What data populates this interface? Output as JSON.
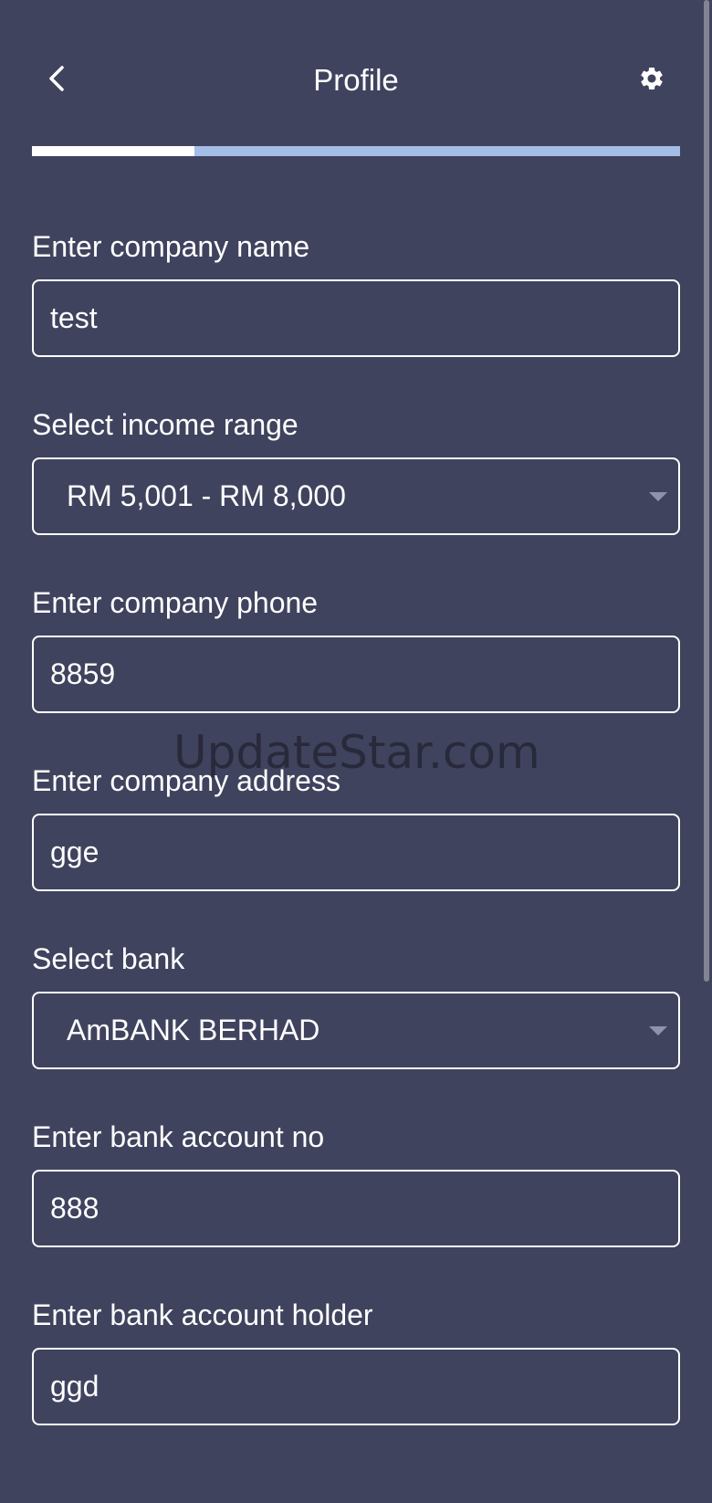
{
  "header": {
    "title": "Profile",
    "back_icon": "chevron-left-icon",
    "settings_icon": "gear-icon"
  },
  "progress": {
    "fraction": 0.25,
    "fill_color": "#ffffff",
    "track_color": "#a3bde6"
  },
  "form": {
    "company_name": {
      "label": "Enter company name",
      "value": "test"
    },
    "income_range": {
      "label": "Select income range",
      "value": "RM 5,001 - RM 8,000"
    },
    "company_phone": {
      "label": "Enter company phone",
      "value": "8859"
    },
    "company_address": {
      "label": "Enter company address",
      "value": "gge"
    },
    "bank": {
      "label": "Select bank",
      "value": "AmBANK BERHAD"
    },
    "bank_account_no": {
      "label": "Enter bank account no",
      "value": "888"
    },
    "bank_account_holder": {
      "label": "Enter bank account holder",
      "value": "ggd"
    }
  },
  "watermark": "UpdateStar.com",
  "colors": {
    "background": "#40435e",
    "text": "#ffffff"
  }
}
